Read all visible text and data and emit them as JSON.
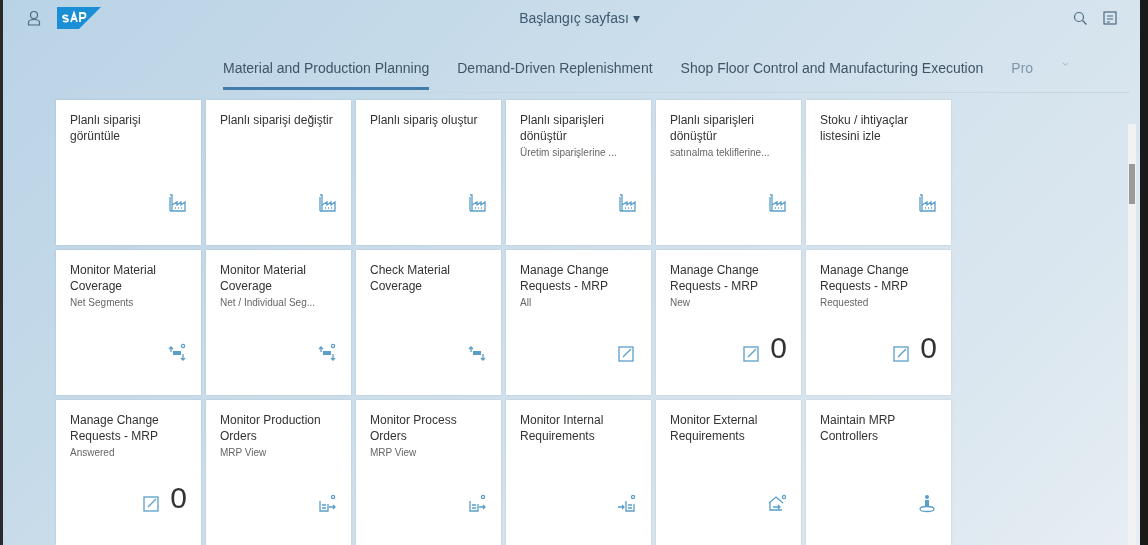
{
  "shell": {
    "title": "Başlangıç sayfası ▾"
  },
  "tabs": [
    {
      "label": "Material and Production Planning",
      "selected": true,
      "faded": false
    },
    {
      "label": "Demand-Driven Replenishment",
      "selected": false,
      "faded": false
    },
    {
      "label": "Shop Floor Control and Manufacturing Execution",
      "selected": false,
      "faded": false
    },
    {
      "label": "Pro",
      "selected": false,
      "faded": true
    }
  ],
  "tiles": [
    {
      "title": "Planlı siparişi görüntüle",
      "kind": "factory"
    },
    {
      "title": "Planlı siparişi değiştir",
      "kind": "factory"
    },
    {
      "title": "Planlı sipariş oluştur",
      "kind": "factory"
    },
    {
      "title": "Planlı siparişleri dönüştür",
      "subtitle": "Üretim siparişlerine ...",
      "kind": "factory"
    },
    {
      "title": "Planlı siparişleri dönüştür",
      "subtitle": "satınalma tekliflerine...",
      "kind": "factory"
    },
    {
      "title": "Stoku / ihtiyaçlar listesini izle",
      "kind": "factory"
    },
    {
      "title": "Monitor Material Coverage",
      "subtitle": "Net Segments",
      "kind": "coveragesearch"
    },
    {
      "title": "Monitor Material Coverage",
      "subtitle": "Net / Individual Seg...",
      "kind": "coveragesearch"
    },
    {
      "title": "Check Material Coverage",
      "kind": "coverage"
    },
    {
      "title": "Manage Change Requests - MRP",
      "subtitle": "All",
      "kind": "edit"
    },
    {
      "title": "Manage Change Requests - MRP",
      "subtitle": "New",
      "kind": "edit",
      "count": "0"
    },
    {
      "title": "Manage Change Requests - MRP",
      "subtitle": "Requested",
      "kind": "edit",
      "count": "0"
    },
    {
      "title": "Manage Change Requests - MRP",
      "subtitle": "Answered",
      "kind": "edit",
      "count": "0"
    },
    {
      "title": "Monitor Production Orders",
      "subtitle": "MRP View",
      "kind": "production"
    },
    {
      "title": "Monitor Process Orders",
      "subtitle": "MRP View",
      "kind": "production"
    },
    {
      "title": "Monitor Internal Requirements",
      "kind": "internal"
    },
    {
      "title": "Monitor External Requirements",
      "kind": "external"
    },
    {
      "title": "Maintain MRP Controllers",
      "kind": "controller"
    }
  ]
}
